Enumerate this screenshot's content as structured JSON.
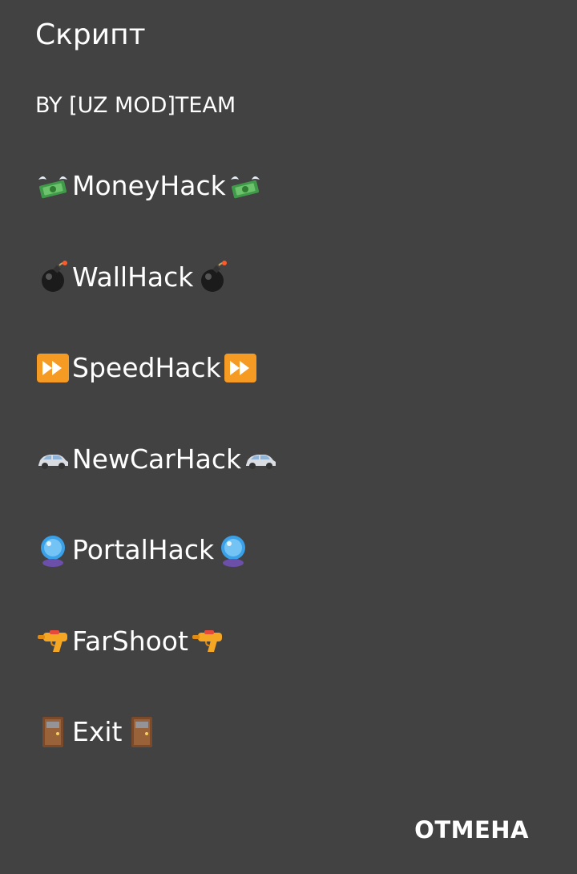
{
  "dialog": {
    "title": "Скрипт",
    "subtitle": "BY [UZ MOD]TEAM",
    "background_color": "#424242",
    "items": [
      {
        "label": "MoneyHack",
        "icon": "flying-money-icon"
      },
      {
        "label": "WallHack",
        "icon": "bomb-icon"
      },
      {
        "label": "SpeedHack",
        "icon": "fast-forward-icon"
      },
      {
        "label": "NewCarHack",
        "icon": "car-icon"
      },
      {
        "label": "PortalHack",
        "icon": "crystal-ball-icon"
      },
      {
        "label": "FarShoot",
        "icon": "water-pistol-icon"
      },
      {
        "label": "Exit",
        "icon": "door-icon"
      }
    ],
    "cancel_label": "ОТМЕНА"
  }
}
